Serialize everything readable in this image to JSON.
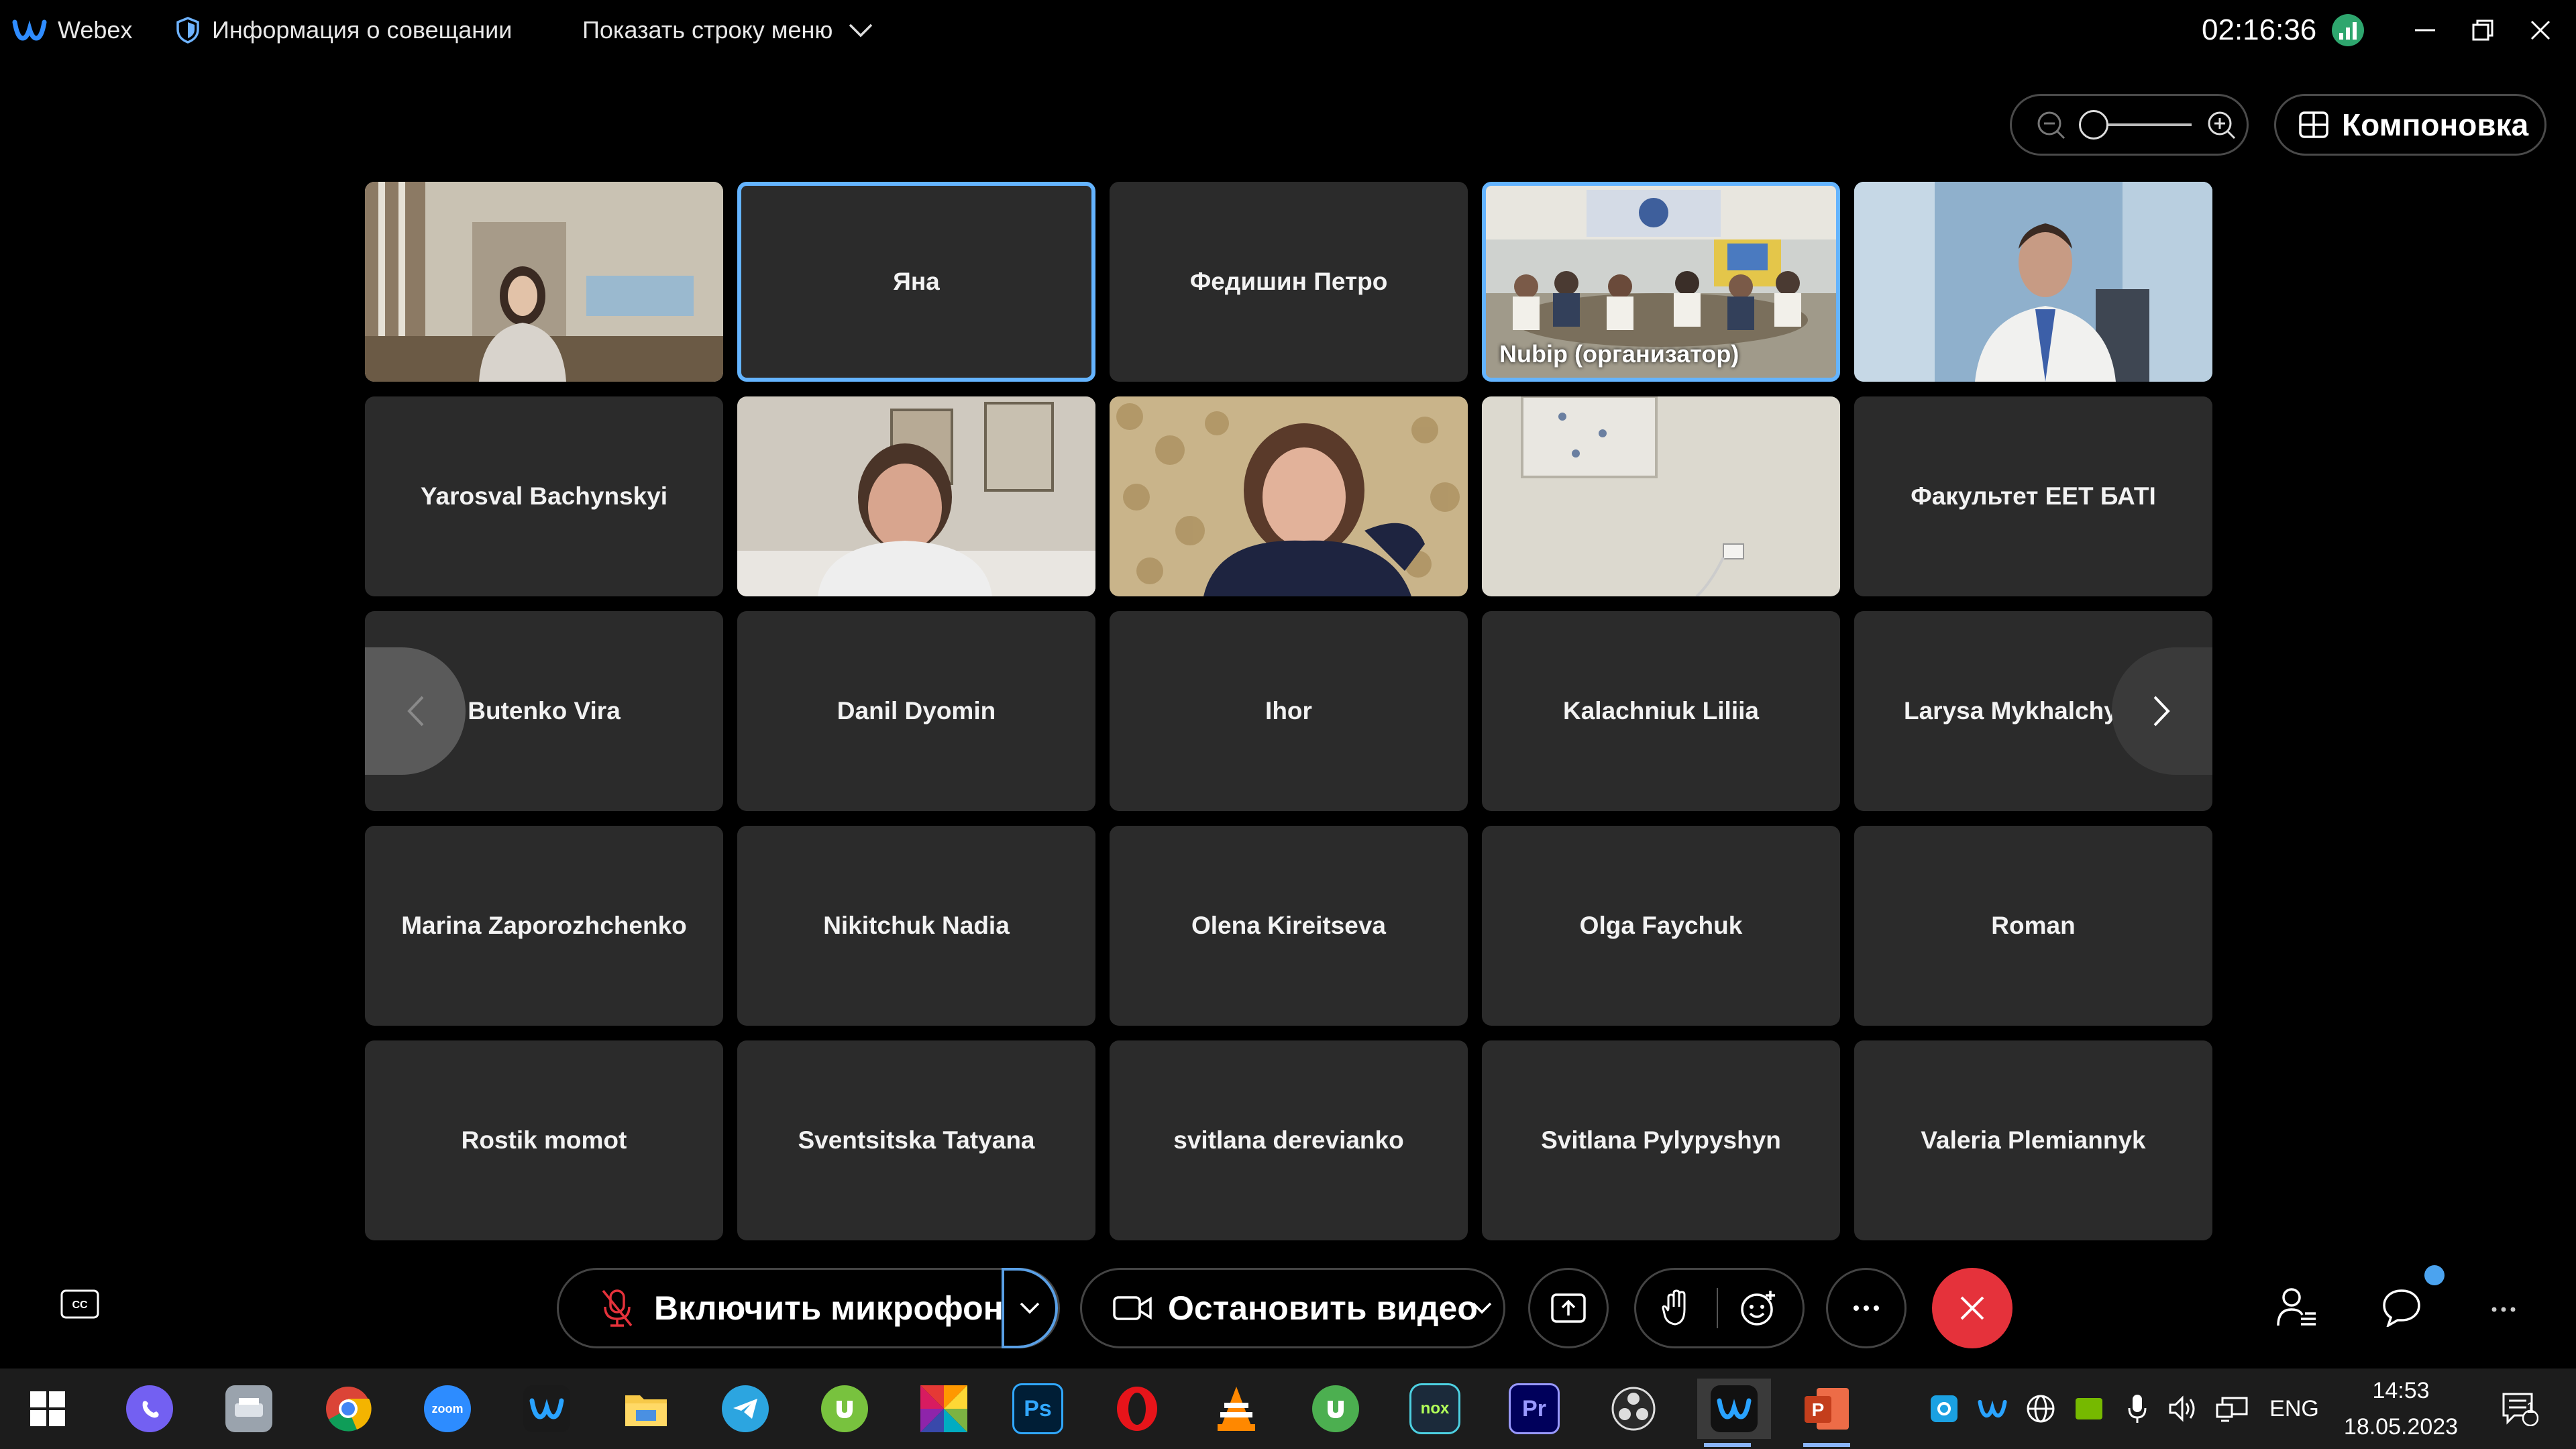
{
  "app": {
    "name": "Webex",
    "meeting_info": "Информация о совещании",
    "show_menu": "Показать строку меню",
    "timer": "02:16:36"
  },
  "toolbar": {
    "layout_label": "Компоновка"
  },
  "participants": [
    {
      "name": "",
      "video": true
    },
    {
      "name": "Яна",
      "video": false,
      "active_speaker": true
    },
    {
      "name": "Федишин Петро",
      "video": false
    },
    {
      "name": "Nubip (организатор)",
      "video": true,
      "active_speaker": true
    },
    {
      "name": "",
      "video": true
    },
    {
      "name": "Yarosval Bachynskyi",
      "video": false
    },
    {
      "name": "",
      "video": true
    },
    {
      "name": "",
      "video": true
    },
    {
      "name": "",
      "video": true
    },
    {
      "name": "Факультет ЕЕТ БАТІ",
      "video": false
    },
    {
      "name": "Butenko Vira",
      "video": false
    },
    {
      "name": "Danil Dyomin",
      "video": false
    },
    {
      "name": "Ihor",
      "video": false
    },
    {
      "name": "Kalachniuk Liliia",
      "video": false
    },
    {
      "name": "Larysa Mykhalchysh",
      "video": false
    },
    {
      "name": "Marina Zaporozhchenko",
      "video": false
    },
    {
      "name": "Nikitchuk Nadia",
      "video": false
    },
    {
      "name": "Olena Kireitseva",
      "video": false
    },
    {
      "name": "Olga Faychuk",
      "video": false
    },
    {
      "name": "Roman",
      "video": false
    },
    {
      "name": "Rostik momot",
      "video": false
    },
    {
      "name": "Sventsitska Tatyana",
      "video": false
    },
    {
      "name": "svitlana derevianko",
      "video": false
    },
    {
      "name": "Svitlana Pylypyshyn",
      "video": false
    },
    {
      "name": "Valeria Plemiannyk",
      "video": false
    }
  ],
  "controls": {
    "mic_label": "Включить микрофон",
    "video_label": "Остановить видео"
  },
  "taskbar": {
    "apps": [
      "windows-start",
      "viber",
      "scanner",
      "chrome",
      "zoom",
      "webex",
      "file-explorer",
      "telegram",
      "utorrent",
      "colors-app",
      "photoshop",
      "opera",
      "vlc",
      "utorrent-green",
      "nox",
      "premiere",
      "obs",
      "webex-active",
      "powerpoint"
    ],
    "zoom_icon_text": "zoom",
    "ps_icon_text": "Ps",
    "pr_icon_text": "Pr",
    "nox_icon_text": "nox",
    "language": "ENG",
    "time": "14:53",
    "date": "18.05.2023",
    "notifications_count": "1"
  },
  "colors": {
    "accent": "#64b4ff",
    "end_call": "#e5323b",
    "tile_bg": "#2b2b2b"
  }
}
